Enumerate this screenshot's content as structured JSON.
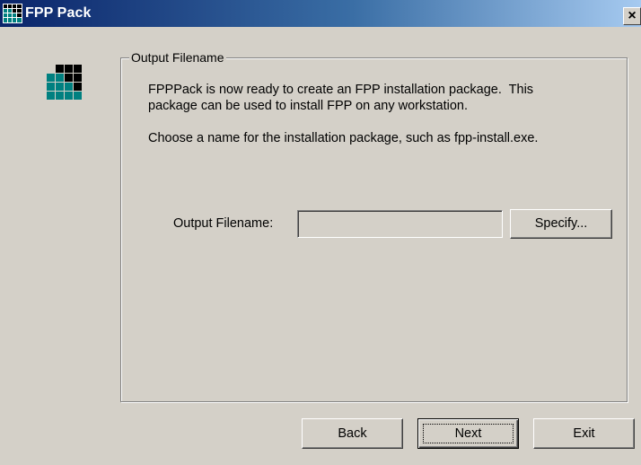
{
  "window": {
    "title": "FPP Pack",
    "close_glyph": "×",
    "icon": "fpp-grid-icon",
    "background": "#d4d0c8",
    "titlebar_gradient": [
      "#0a246a",
      "#a6caf0"
    ]
  },
  "group": {
    "legend": "Output Filename"
  },
  "description": {
    "line1": "FPPPack is now ready to create an FPP installation package.  This",
    "line2": "package can be used to install FPP on any workstation.",
    "line3": "Choose a name for the installation package, such as fpp-install.exe."
  },
  "form": {
    "output_label": "Output Filename:",
    "output_value": "",
    "specify_label": "Specify..."
  },
  "buttons": {
    "back": "Back",
    "next": "Next",
    "exit": "Exit"
  },
  "logo": {
    "icon": "fpp-logo-icon",
    "colors": [
      "#000000",
      "#008080",
      "#ffffff"
    ]
  }
}
